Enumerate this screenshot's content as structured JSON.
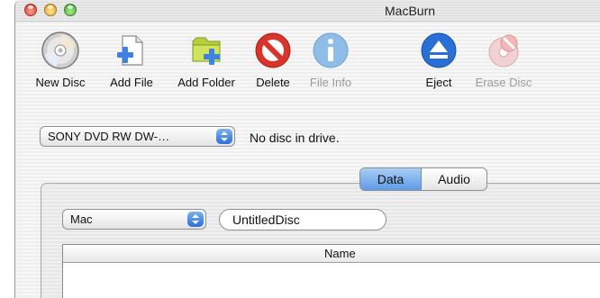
{
  "window": {
    "title": "MacBurn"
  },
  "toolbar": {
    "new_disc": "New Disc",
    "add_file": "Add File",
    "add_folder": "Add Folder",
    "delete": "Delete",
    "file_info": "File Info",
    "eject": "Eject",
    "erase_disc": "Erase Disc"
  },
  "drive": {
    "selected": "SONY DVD RW DW-…",
    "status": "No disc in drive."
  },
  "tabs": {
    "data": "Data",
    "audio": "Audio",
    "selected": "Data"
  },
  "disc": {
    "format": "Mac",
    "name": "UntitledDisc"
  },
  "table": {
    "columns": [
      "Name"
    ]
  },
  "colors": {
    "accent": "#3e82e0",
    "delete": "#d9342a",
    "info": "#4c8fd9"
  }
}
